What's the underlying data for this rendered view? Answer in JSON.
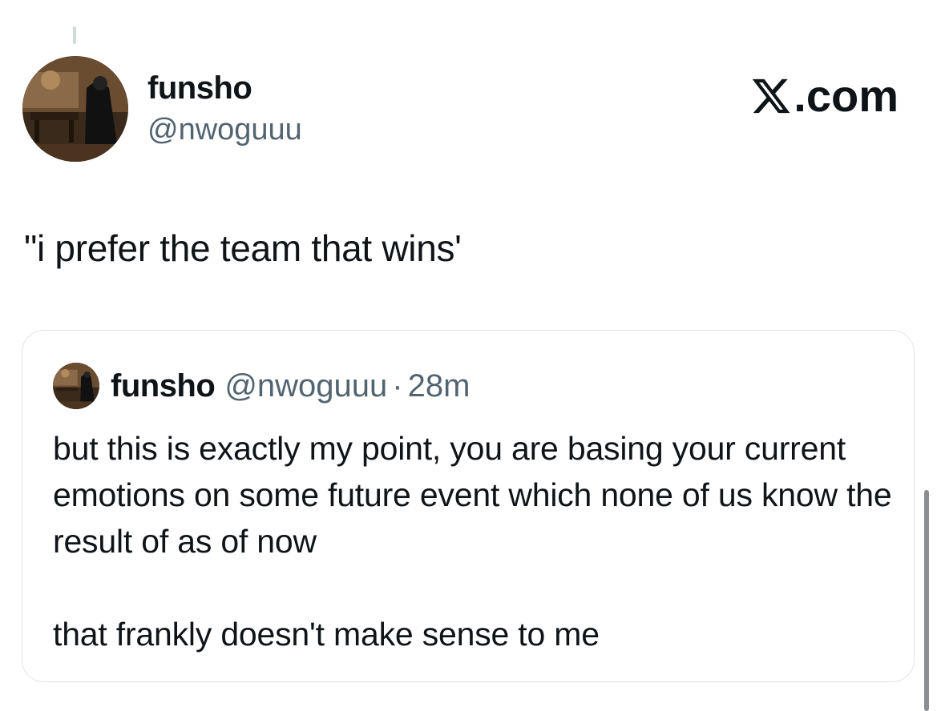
{
  "author": {
    "display_name": "funsho",
    "handle": "@nwoguuu",
    "avatar_icon": "profile-photo-icon"
  },
  "brand": {
    "label": ".com",
    "logo_icon": "x-logo-icon"
  },
  "tweet": {
    "text": "\"i prefer the team that wins'"
  },
  "quoted_tweet": {
    "display_name": "funsho",
    "handle": "@nwoguuu",
    "separator": "·",
    "time": "28m",
    "paragraphs": [
      "but this is exactly my point, you are basing your current emotions on some future event which none of us know the result of as of now",
      "that frankly doesn't make sense to me"
    ]
  },
  "colors": {
    "text_primary": "#0f1419",
    "text_secondary": "#536471",
    "border": "#dfe3e6"
  }
}
